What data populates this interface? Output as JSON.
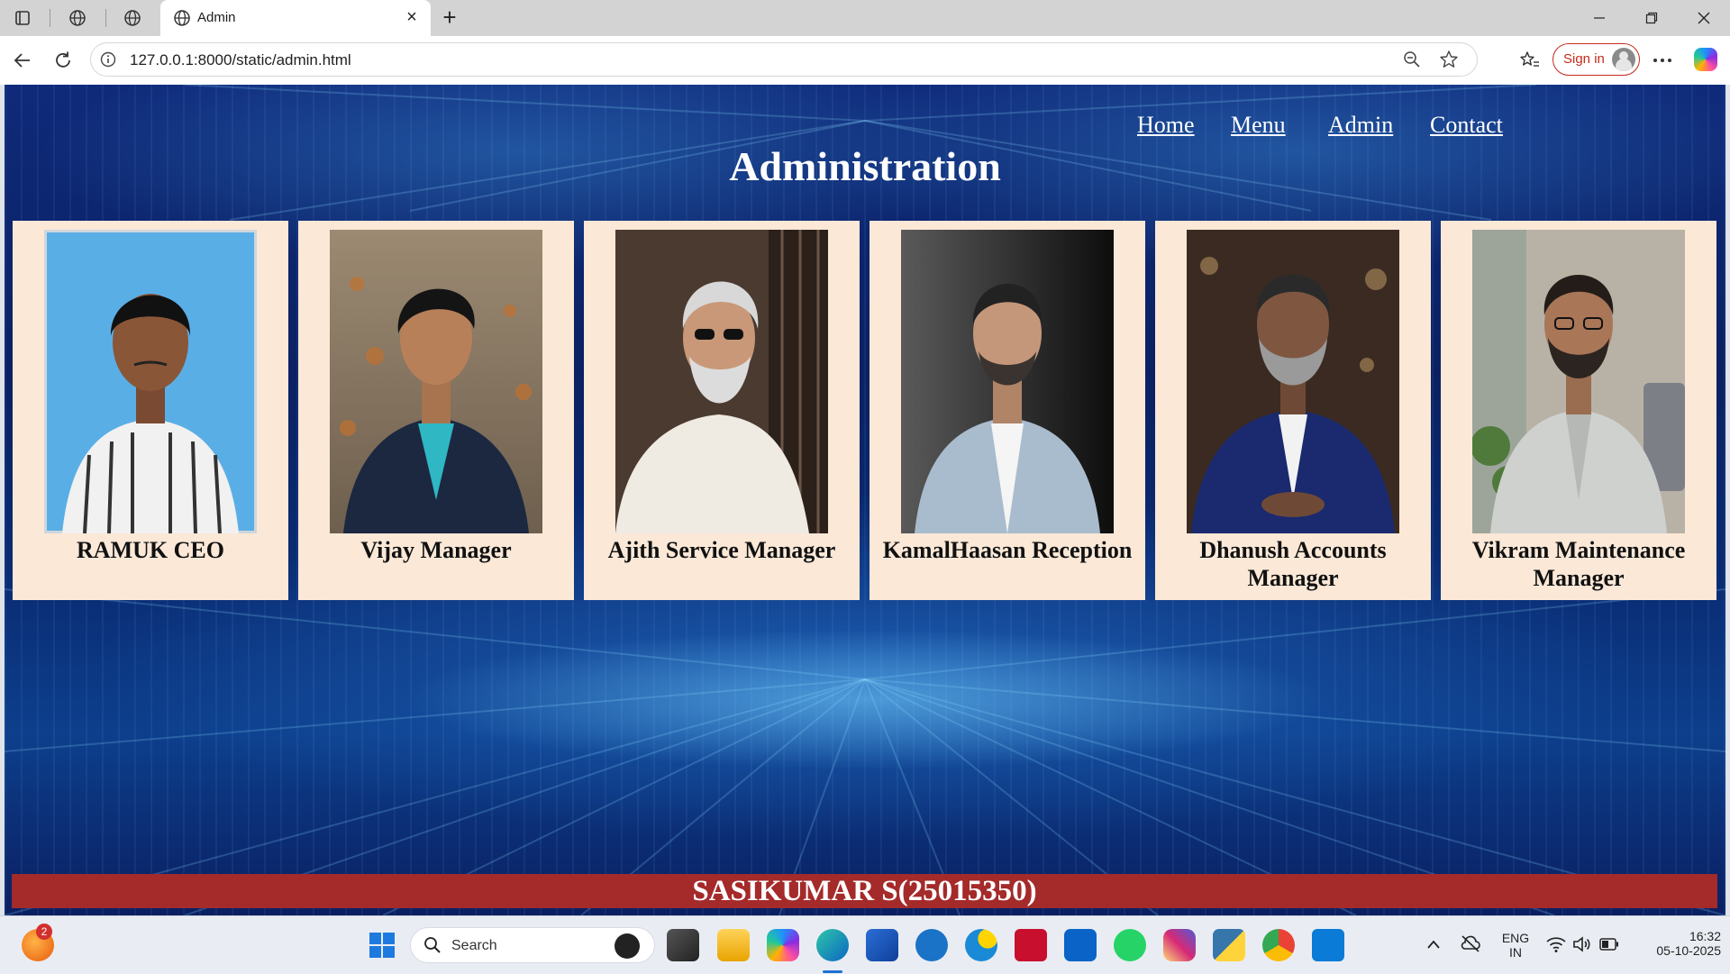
{
  "browser": {
    "tab_title": "Admin",
    "url": "127.0.0.1:8000/static/admin.html",
    "sign_in_label": "Sign in"
  },
  "page": {
    "nav": [
      "Home",
      "Menu",
      "Admin",
      "Contact"
    ],
    "title": "Administration",
    "cards": [
      {
        "label": "RAMUK CEO"
      },
      {
        "label": "Vijay Manager"
      },
      {
        "label": "Ajith Service Manager"
      },
      {
        "label": "KamalHaasan Reception"
      },
      {
        "label": "Dhanush Accounts Manager"
      },
      {
        "label": "Vikram Maintenance Manager"
      }
    ],
    "footer": "SASIKUMAR S(25015350)"
  },
  "taskbar": {
    "search_label": "Search",
    "notification_count": "2",
    "lang_1": "ENG",
    "lang_2": "IN",
    "time": "16:32",
    "date": "05-10-2025"
  },
  "colors": {
    "card_bg": "#fbe8d7",
    "footer_bg": "#a52a2a",
    "page_bg": "#0b2163"
  }
}
